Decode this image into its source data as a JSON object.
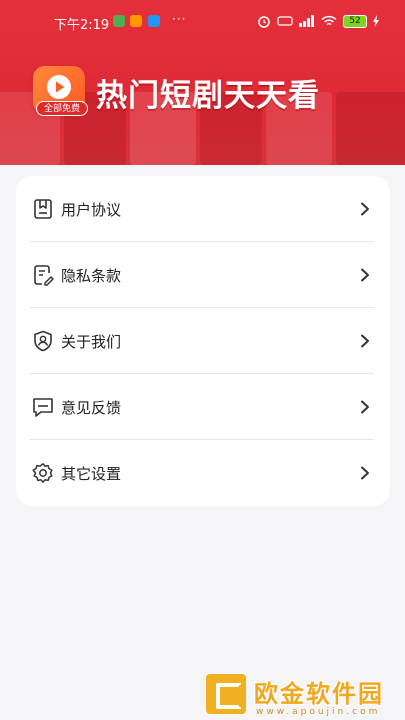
{
  "status_bar": {
    "time": "下午2:19",
    "dots": "···",
    "battery": "52"
  },
  "header": {
    "logo_tag": "全部免费",
    "title": "热门短剧天天看"
  },
  "menu": {
    "items": [
      {
        "label": "用户协议",
        "icon": "document-icon"
      },
      {
        "label": "隐私条款",
        "icon": "edit-document-icon"
      },
      {
        "label": "关于我们",
        "icon": "shield-user-icon"
      },
      {
        "label": "意见反馈",
        "icon": "chat-bubble-icon"
      },
      {
        "label": "其它设置",
        "icon": "gear-icon"
      }
    ]
  },
  "watermark": {
    "text": "欧金软件园",
    "url": "www.apoujin.com"
  },
  "colors": {
    "header_red": "#e5303c",
    "accent_orange": "#ff6a2a",
    "text": "#222222"
  }
}
